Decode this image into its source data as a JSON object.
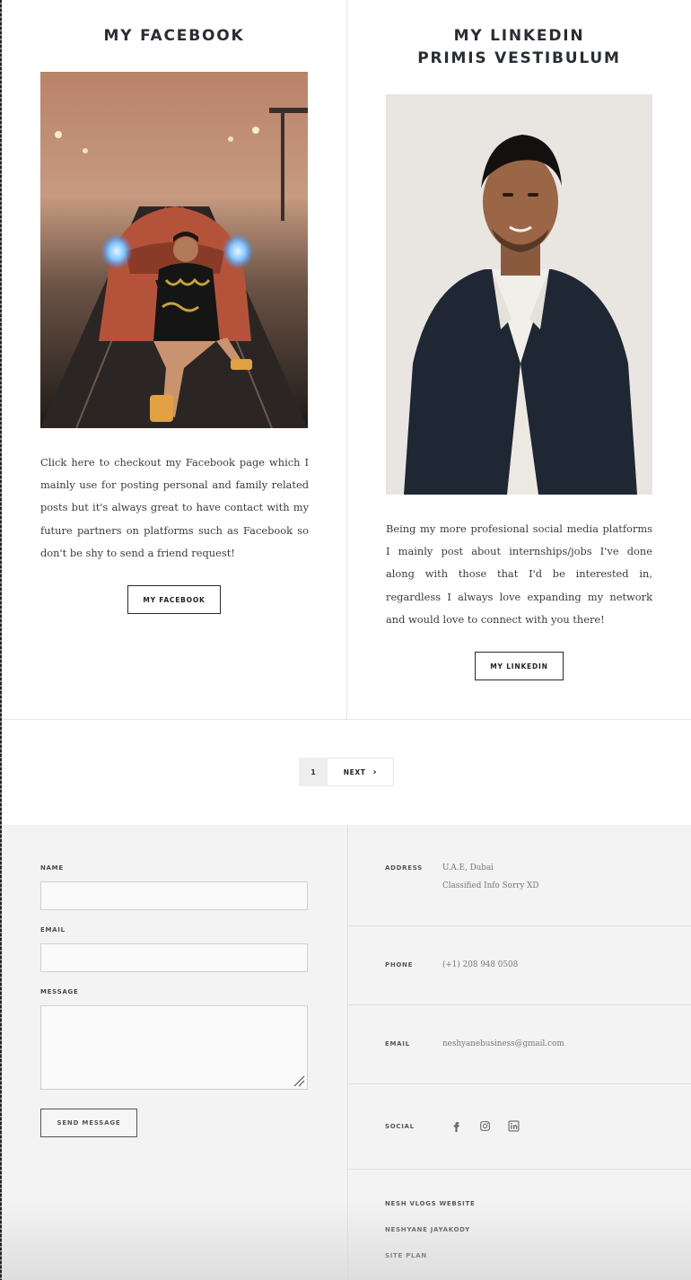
{
  "posts": [
    {
      "title": "MY FACEBOOK",
      "text": "Click here to checkout my Facebook page which I mainly use for posting personal and family related posts but it's always great to have contact with my future partners on platforms such as Facebook so don't be shy to send a friend request!",
      "button": "MY FACEBOOK"
    },
    {
      "title_line1": "MY LINKEDIN",
      "title_line2": "PRIMIS VESTIBULUM",
      "text": "Being my more profesional social media platforms I mainly post about internships/jobs I've done along with those that I'd be interested in, regardless I always love expanding my network and would love to connect with you there!",
      "button": "MY LINKEDIN"
    }
  ],
  "pagination": {
    "current": "1",
    "next": "NEXT"
  },
  "contact_form": {
    "name_label": "NAME",
    "email_label": "EMAIL",
    "message_label": "MESSAGE",
    "submit": "SEND MESSAGE"
  },
  "contact_info": {
    "address_label": "ADDRESS",
    "address_line1": "U.A.E, Dubai",
    "address_line2": "Classified Info Sorry XD",
    "phone_label": "PHONE",
    "phone": "(+1) 208 948 0508",
    "email_label": "EMAIL",
    "email": "neshyanebusiness@gmail.com",
    "social_label": "SOCIAL",
    "social_icons": [
      "facebook-icon",
      "instagram-icon",
      "linkedin-icon"
    ]
  },
  "footer_links": [
    "NESH VLOGS WEBSITE",
    "NESHYANE JAYAKODY",
    "SITE PLAN"
  ],
  "colors": {
    "title": "#2a2d35",
    "footer_bg": "#f3f3f3",
    "border": "#e6e6e6"
  }
}
